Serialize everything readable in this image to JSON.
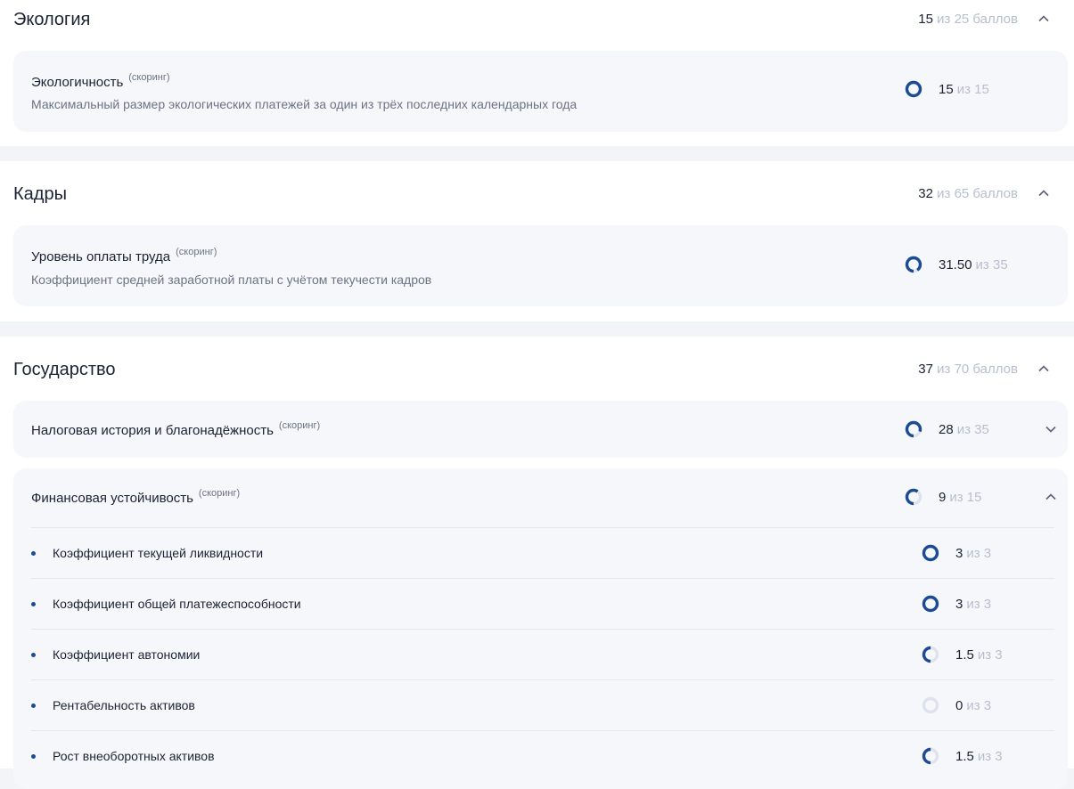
{
  "colors": {
    "accent": "#1c4b94",
    "track": "#dde2ec",
    "muted": "#b7bfcf"
  },
  "sections": [
    {
      "title": "Экология",
      "score": "15",
      "of": "из 25 баллов",
      "chevron": "chevron-up-icon",
      "cards": [
        {
          "title": "Экологичность",
          "tag": "(скоринг)",
          "description": "Максимальный размер экологических платежей за один из трёх последних календарных года",
          "value": "15",
          "of": "из 15",
          "fraction": 1.0
        }
      ]
    },
    {
      "title": "Кадры",
      "score": "32",
      "of": "из 65 баллов",
      "chevron": "chevron-up-icon",
      "cards": [
        {
          "title": "Уровень оплаты труда",
          "tag": "(скоринг)",
          "description": "Коэффициент средней заработной платы с учётом текучести кадров",
          "value": "31.50",
          "of": "из 35",
          "fraction": 0.9
        }
      ]
    },
    {
      "title": "Государство",
      "score": "37",
      "of": "из 70 баллов",
      "chevron": "chevron-up-icon",
      "cards": [
        {
          "title": "Налоговая история и благонадёжность",
          "tag": "(скоринг)",
          "value": "28",
          "of": "из 35",
          "fraction": 0.8,
          "chevron": "chevron-down-icon"
        },
        {
          "title": "Финансовая устойчивость",
          "tag": "(скоринг)",
          "value": "9",
          "of": "из 15",
          "fraction": 0.6,
          "chevron": "chevron-up-icon",
          "items": [
            {
              "label": "Коэффициент текущей ликвидности",
              "value": "3",
              "of": "из 3",
              "fraction": 1.0
            },
            {
              "label": "Коэффициент общей платежеспособности",
              "value": "3",
              "of": "из 3",
              "fraction": 1.0
            },
            {
              "label": "Коэффициент автономии",
              "value": "1.5",
              "of": "из 3",
              "fraction": 0.5
            },
            {
              "label": "Рентабельность активов",
              "value": "0",
              "of": "из 3",
              "fraction": 0.0
            },
            {
              "label": "Рост внеоборотных активов",
              "value": "1.5",
              "of": "из 3",
              "fraction": 0.5
            }
          ]
        }
      ]
    }
  ]
}
